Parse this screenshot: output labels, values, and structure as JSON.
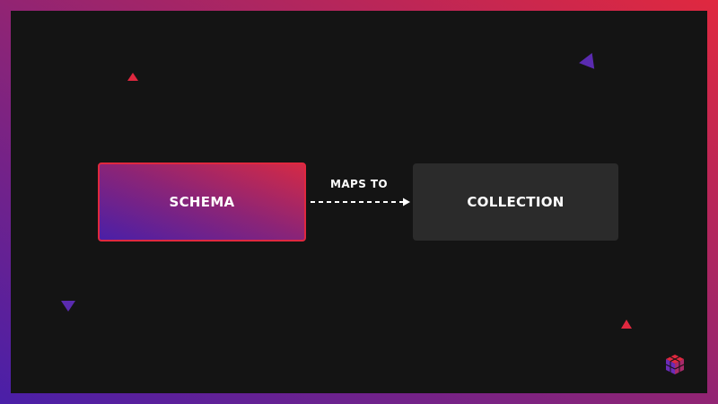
{
  "diagram": {
    "nodes": {
      "schema": {
        "label": "SCHEMA"
      },
      "collection": {
        "label": "COLLECTION"
      }
    },
    "edge": {
      "label": "MAPS TO",
      "style": "dashed",
      "direction": "schema-to-collection"
    }
  },
  "colors": {
    "canvas_background": "#141414",
    "accent_red": "#e0283f",
    "accent_purple": "#5a2bb0",
    "collection_fill": "#2b2b2b",
    "text": "#ffffff"
  },
  "decorations": [
    "triangle-red",
    "triangle-purple",
    "triangle-purple",
    "triangle-red"
  ],
  "logo": {
    "icon": "cube-grid-logo-icon"
  }
}
